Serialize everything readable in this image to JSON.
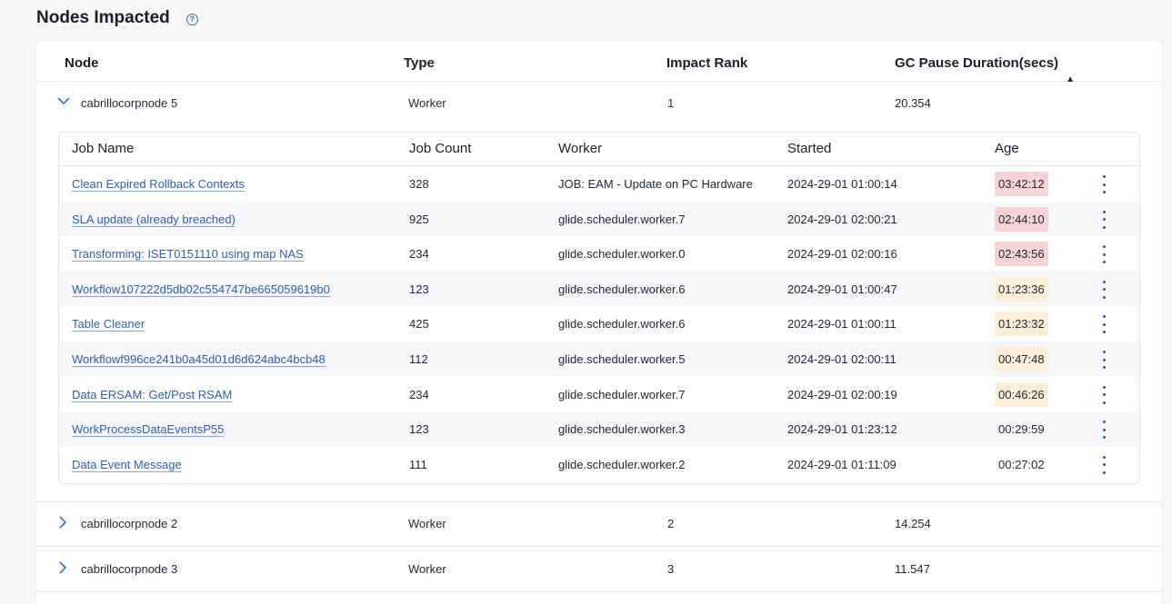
{
  "title": "Nodes Impacted",
  "columns": {
    "node": "Node",
    "type": "Type",
    "impact_rank": "Impact Rank",
    "gc_pause": "GC Pause Duration(secs)"
  },
  "sort_icon": "▲",
  "nodes": [
    {
      "name": "cabrillocorpnode 5",
      "type": "Worker",
      "rank": "1",
      "gc": "20.354",
      "expanded": true
    },
    {
      "name": "cabrillocorpnode 2",
      "type": "Worker",
      "rank": "2",
      "gc": "14.254",
      "expanded": false
    },
    {
      "name": "cabrillocorpnode 3",
      "type": "Worker",
      "rank": "3",
      "gc": "11.547",
      "expanded": false
    }
  ],
  "job_columns": {
    "name": "Job Name",
    "count": "Job Count",
    "worker": "Worker",
    "started": "Started",
    "age": "Age"
  },
  "jobs": [
    {
      "name": "Clean Expired Rollback Contexts",
      "count": "328",
      "worker": "JOB: EAM - Update on PC Hardware",
      "started": "2024-29-01 01:00:14",
      "age": "03:42:12",
      "severity": "red"
    },
    {
      "name": "SLA update (already breached)",
      "count": "925",
      "worker": "glide.scheduler.worker.7",
      "started": "2024-29-01 02:00:21",
      "age": "02:44:10",
      "severity": "red"
    },
    {
      "name": "Transforming: ISET0151110 using map NAS",
      "count": "234",
      "worker": "glide.scheduler.worker.0",
      "started": "2024-29-01 02:00:16",
      "age": "02:43:56",
      "severity": "red"
    },
    {
      "name": "Workflow107222d5db02c554747be665059619b0",
      "count": "123",
      "worker": "glide.scheduler.worker.6",
      "started": "2024-29-01 01:00:47",
      "age": "01:23:36",
      "severity": "yellow"
    },
    {
      "name": "Table Cleaner",
      "count": "425",
      "worker": "glide.scheduler.worker.6",
      "started": "2024-29-01 01:00:11",
      "age": "01:23:32",
      "severity": "yellow"
    },
    {
      "name": "Workflowf996ce241b0a45d01d6d624abc4bcb48",
      "count": "112",
      "worker": "glide.scheduler.worker.5",
      "started": "2024-29-01 02:00:11",
      "age": "00:47:48",
      "severity": "yellow"
    },
    {
      "name": "Data ERSAM: Get/Post RSAM",
      "count": "234",
      "worker": "glide.scheduler.worker.7",
      "started": "2024-29-01 02:00:19",
      "age": "00:46:26",
      "severity": "yellow"
    },
    {
      "name": "WorkProcessDataEventsP55",
      "count": "123",
      "worker": "glide.scheduler.worker.3",
      "started": "2024-29-01 01:23:12",
      "age": "00:29:59",
      "severity": "none"
    },
    {
      "name": "Data Event Message",
      "count": "111",
      "worker": "glide.scheduler.worker.2",
      "started": "2024-29-01 01:11:09",
      "age": "00:27:02",
      "severity": "none"
    }
  ],
  "colors": {
    "age_red": "#f6d3d6",
    "age_yellow": "#fbefd7",
    "link": "#2f5fa6"
  }
}
